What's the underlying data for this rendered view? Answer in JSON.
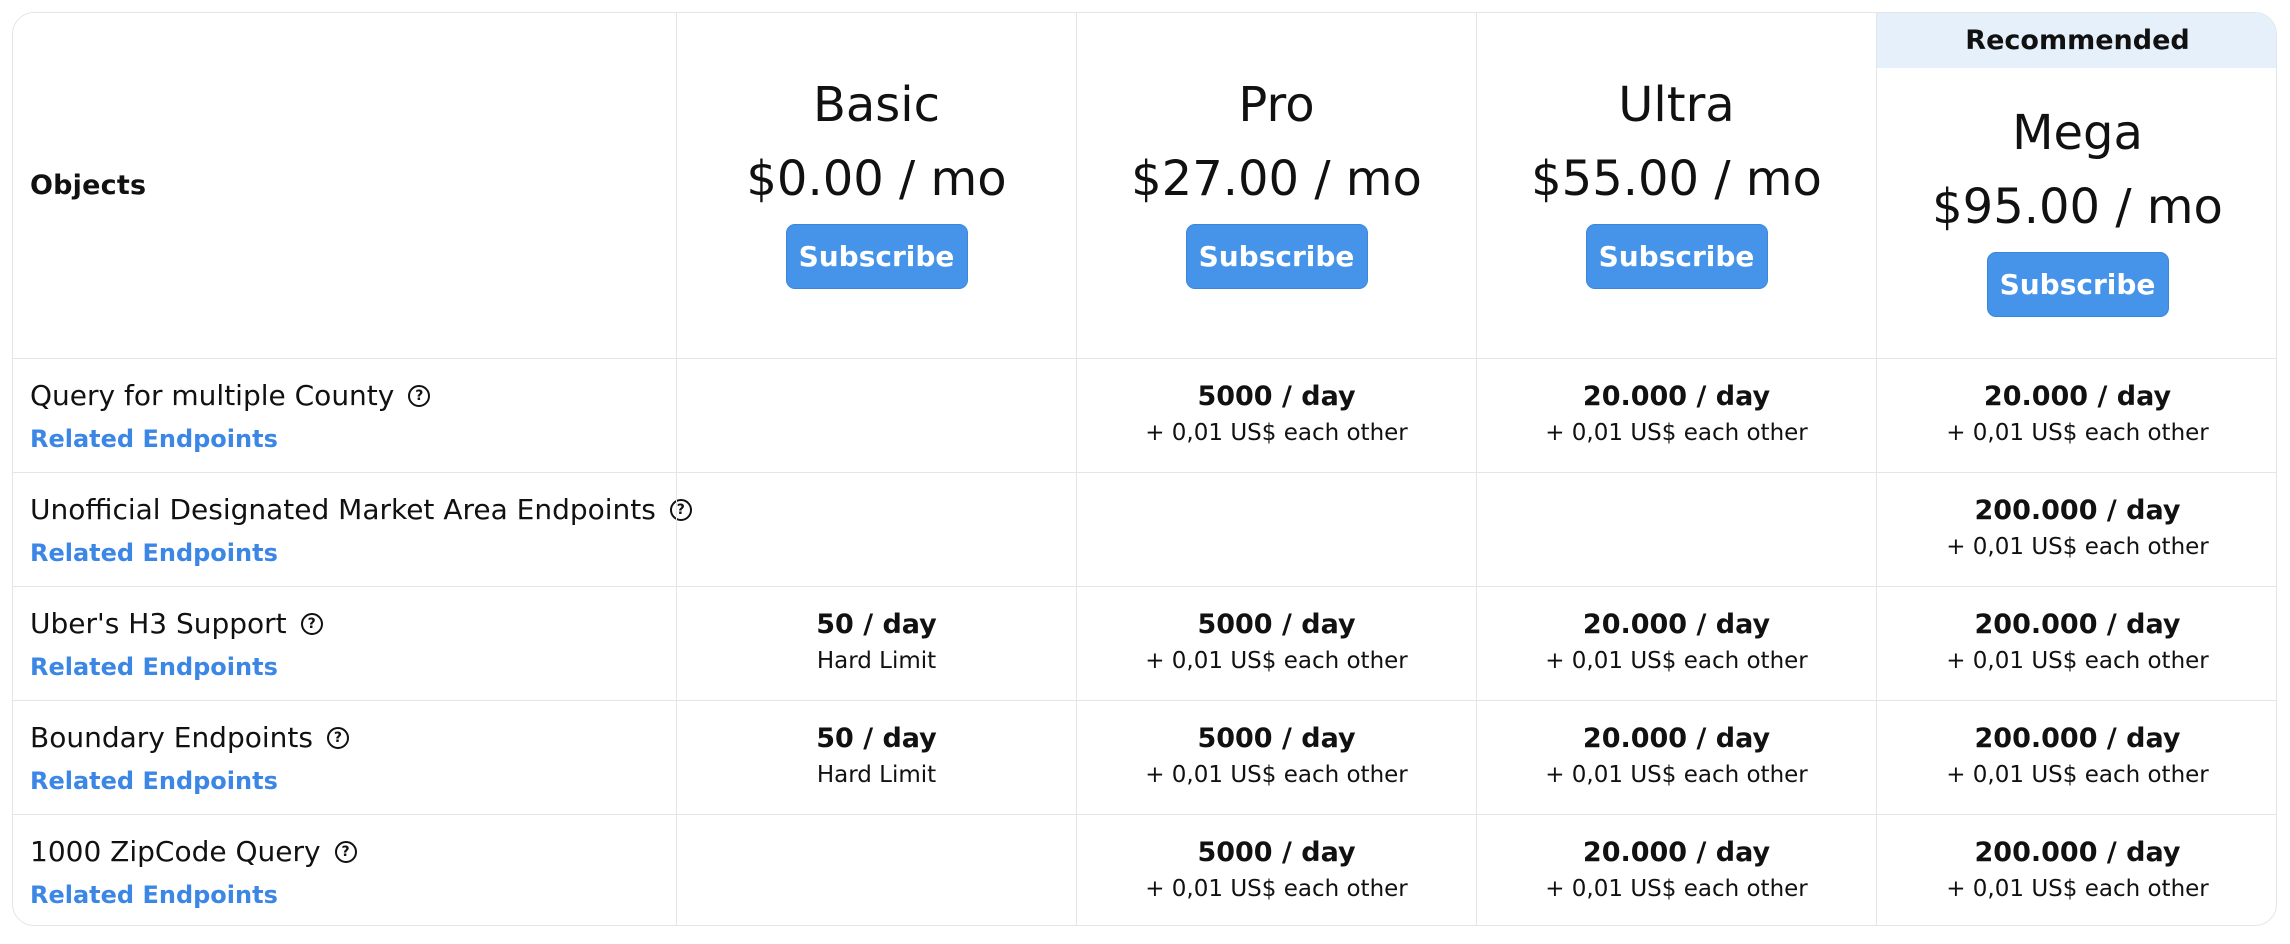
{
  "header": {
    "objects_label": "Objects",
    "recommended_label": "Recommended",
    "plans": [
      {
        "name": "Basic",
        "price": "$0.00 / mo",
        "subscribe_label": "Subscribe"
      },
      {
        "name": "Pro",
        "price": "$27.00 / mo",
        "subscribe_label": "Subscribe"
      },
      {
        "name": "Ultra",
        "price": "$55.00 / mo",
        "subscribe_label": "Subscribe"
      },
      {
        "name": "Mega",
        "price": "$95.00 / mo",
        "subscribe_label": "Subscribe"
      }
    ]
  },
  "colors": {
    "accent": "#4594ea",
    "link": "#3c87e6",
    "recommended_bg": "#e6f0fb",
    "border": "#e3e5e8"
  },
  "related_label": "Related Endpoints",
  "help_icon": "question-circle-icon",
  "features": [
    {
      "title": "Query for multiple County",
      "quotas": [
        null,
        {
          "main": "5000 / day",
          "sub": "+ 0,01 US$ each other"
        },
        {
          "main": "20.000 / day",
          "sub": "+ 0,01 US$ each other"
        },
        {
          "main": "20.000 / day",
          "sub": "+ 0,01 US$ each other"
        }
      ]
    },
    {
      "title": "Unofficial Designated Market Area Endpoints",
      "quotas": [
        null,
        null,
        null,
        {
          "main": "200.000 / day",
          "sub": "+ 0,01 US$ each other"
        }
      ]
    },
    {
      "title": "Uber's H3 Support",
      "quotas": [
        {
          "main": "50 / day",
          "sub": "Hard Limit"
        },
        {
          "main": "5000 / day",
          "sub": "+ 0,01 US$ each other"
        },
        {
          "main": "20.000 / day",
          "sub": "+ 0,01 US$ each other"
        },
        {
          "main": "200.000 / day",
          "sub": "+ 0,01 US$ each other"
        }
      ]
    },
    {
      "title": "Boundary Endpoints",
      "quotas": [
        {
          "main": "50 / day",
          "sub": "Hard Limit"
        },
        {
          "main": "5000 / day",
          "sub": "+ 0,01 US$ each other"
        },
        {
          "main": "20.000 / day",
          "sub": "+ 0,01 US$ each other"
        },
        {
          "main": "200.000 / day",
          "sub": "+ 0,01 US$ each other"
        }
      ]
    },
    {
      "title": "1000 ZipCode Query",
      "quotas": [
        null,
        {
          "main": "5000 / day",
          "sub": "+ 0,01 US$ each other"
        },
        {
          "main": "20.000 / day",
          "sub": "+ 0,01 US$ each other"
        },
        {
          "main": "200.000 / day",
          "sub": "+ 0,01 US$ each other"
        }
      ]
    }
  ]
}
